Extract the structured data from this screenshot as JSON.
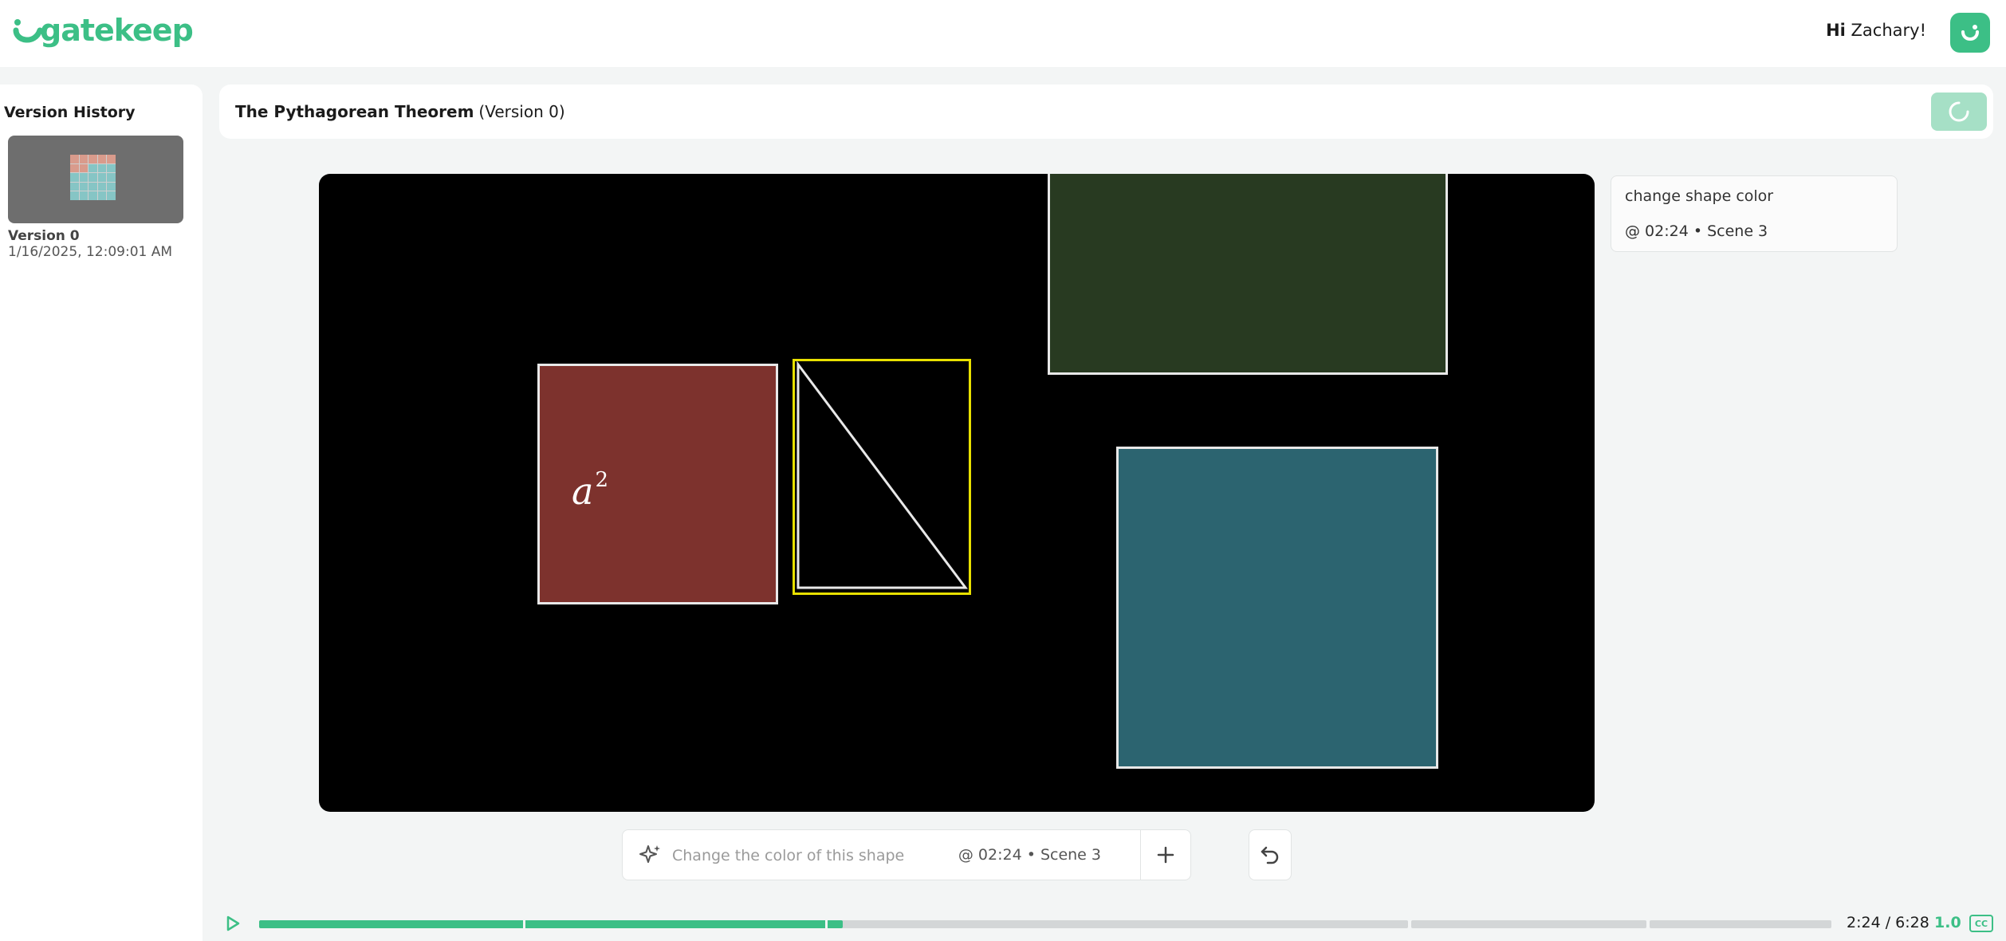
{
  "header": {
    "logo_text": "gatekeep",
    "greeting_prefix": "Hi",
    "user_name": "Zachary!"
  },
  "sidebar": {
    "title": "Version History",
    "versions": [
      {
        "name": "Version 0",
        "date": "1/16/2025, 12:09:01 AM"
      }
    ]
  },
  "document": {
    "title": "The Pythagorean Theorem",
    "version_label": "(Version 0)"
  },
  "video": {
    "math_label": "a",
    "math_exponent": "2"
  },
  "comment": {
    "text": "change shape color",
    "meta": "@ 02:24 • Scene 3"
  },
  "prompt": {
    "placeholder": "Change the color of this shape",
    "meta": "@ 02:24 • Scene 3"
  },
  "player": {
    "time": "2:24 / 6:28",
    "speed": "1.0",
    "cc_label": "CC",
    "progress_fraction": 0.371
  },
  "colors": {
    "brand": "#3cbf86",
    "video_green": "#283a21",
    "video_red": "#7d322d",
    "video_teal": "#2c6470",
    "highlight_yellow": "#e8e000"
  },
  "icons": [
    "logo-smile-icon",
    "avatar-smile-icon",
    "refresh-icon",
    "sparkle-icon",
    "plus-icon",
    "undo-icon",
    "play-icon",
    "cc-icon"
  ]
}
